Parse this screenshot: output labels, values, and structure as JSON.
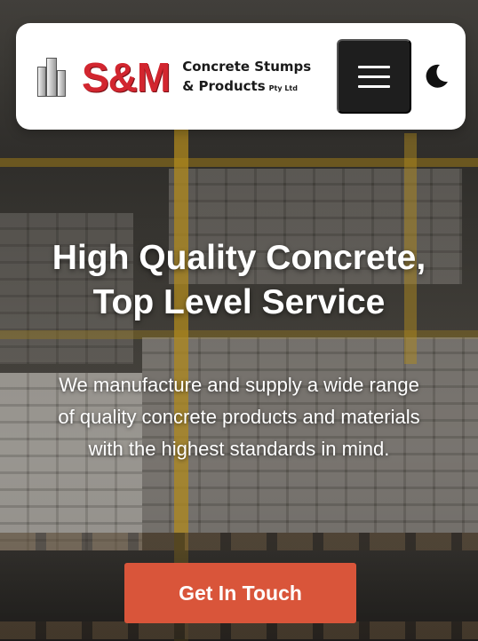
{
  "header": {
    "logo": {
      "brand": "S&M",
      "line1": "Concrete Stumps",
      "line2": "& Products",
      "line2_small": "Pty Ltd"
    },
    "menu_icon": "hamburger-menu-icon",
    "theme_icon": "moon-icon"
  },
  "hero": {
    "title_line1": "High Quality Concrete,",
    "title_line2": "Top Level Service",
    "subtitle": "We manufacture and supply a wide range of quality concrete products and materials with the highest standards in mind.",
    "cta_label": "Get In Touch"
  },
  "colors": {
    "brand_red": "#d2262f",
    "cta_orange": "#d9553a",
    "menu_dark": "#1e1e1e",
    "header_bg": "#ffffff"
  }
}
